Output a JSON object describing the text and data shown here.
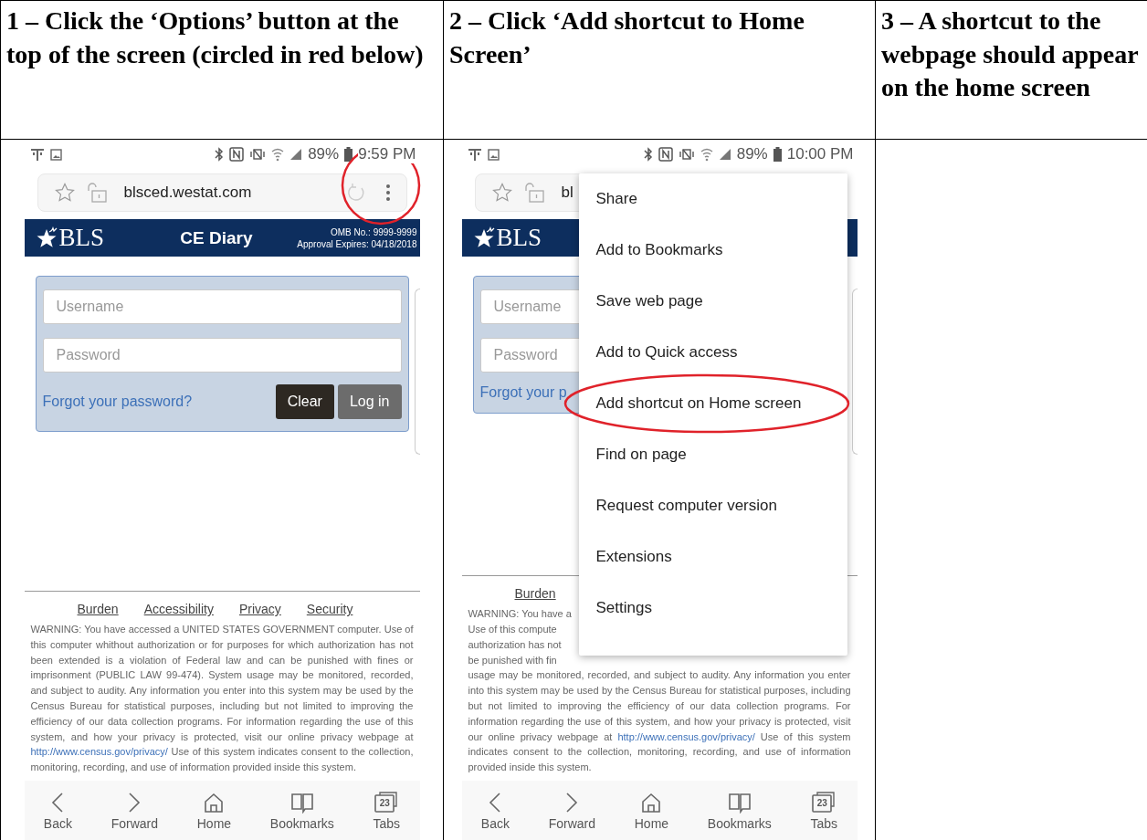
{
  "steps": [
    {
      "heading": "1 – Click the ‘Options’ button at the top of the screen (circled in red below)",
      "screenshot": {
        "battery": "89%",
        "time": "9:59 PM",
        "url": "blsced.westat.com",
        "address_icons": [
          {
            "kind": "star"
          },
          {
            "kind": "lock"
          },
          {
            "kind": "reload"
          },
          {
            "kind": "options"
          }
        ],
        "options_circled": true,
        "logo": "BLS",
        "title": "CE Diary",
        "omb": "OMB No.: 9999-9999",
        "approval": "Approval Expires: 04/18/2018",
        "username_placeholder": "Username",
        "password_placeholder": "Password",
        "forgot_link": "Forgot your password?",
        "buttons": [
          {
            "label": "Clear",
            "kind": "dark"
          },
          {
            "label": "Log in",
            "kind": "grey"
          }
        ],
        "footer_links": [
          "Burden",
          "Accessibility",
          "Privacy",
          "Security"
        ],
        "warning": {
          "before": "WARNING: You have accessed a UNITED STATES GOVERNMENT computer. Use of this computer whithout authorization or for purposes for which authorization has not been extended is a violation of Federal law and can be punished with fines or imprisonment (PUBLIC LAW 99-474). System usage may be monitored, recorded, and subject to audity. Any information you enter into this system may be used by the Census Bureau for statistical purposes, including but not limited to improving the efficiency of our data collection programs. For information regarding the use of this system, and how your privacy is protected, visit our online privacy webpage at",
          "link": "http://www.census.gov/privacy/",
          "after": "Use of this system indicates consent to the collection, monitoring, recording, and use of information provided inside this system."
        },
        "nav": [
          {
            "label": "Back",
            "kind": "back"
          },
          {
            "label": "Forward",
            "kind": "forward"
          },
          {
            "label": "Home",
            "kind": "home"
          },
          {
            "label": "Bookmarks",
            "kind": "bookmarks"
          },
          {
            "label": "Tabs",
            "kind": "tabs",
            "count": "23"
          }
        ]
      }
    },
    {
      "heading": "2 – Click ‘Add shortcut to Home Screen’",
      "screenshot": {
        "battery": "89%",
        "time": "10:00 PM",
        "url": "bl",
        "address_icons": [
          {
            "kind": "star"
          },
          {
            "kind": "lock"
          }
        ],
        "logo": "BLS",
        "username_placeholder": "Username",
        "password_placeholder": "Password",
        "forgot_link": "Forgot your p",
        "footer_links": [
          "Burden"
        ],
        "warning_cut_lines": [
          "WARNING: You have a",
          "Use of this compute",
          "authorization has not",
          "be punished with fin"
        ],
        "warning": {
          "before": "usage may be monitored, recorded, and subject to audity. Any information you enter into this system may be used by the Census Bureau for statistical purposes, including but not limited to improving the efficiency of our data collection programs. For information regarding the use of this system, and how your privacy is protected, visit our online privacy webpage at",
          "link": "http://www.census.gov/privacy/",
          "after": "Use of this system indicates consent to the collection, monitoring, recording, and use of information provided inside this system."
        },
        "menu": [
          {
            "label": "Share",
            "circled": false
          },
          {
            "label": "Add to Bookmarks",
            "circled": false
          },
          {
            "label": "Save web page",
            "circled": false
          },
          {
            "label": "Add to Quick access",
            "circled": false
          },
          {
            "label": "Add shortcut on Home screen",
            "circled": true
          },
          {
            "label": "Find on page",
            "circled": false
          },
          {
            "label": "Request computer version",
            "circled": false
          },
          {
            "label": "Extensions",
            "circled": false
          },
          {
            "label": "Settings",
            "circled": false
          }
        ],
        "nav": [
          {
            "label": "Back",
            "kind": "back"
          },
          {
            "label": "Forward",
            "kind": "forward"
          },
          {
            "label": "Home",
            "kind": "home"
          },
          {
            "label": "Bookmarks",
            "kind": "bookmarks"
          },
          {
            "label": "Tabs",
            "kind": "tabs",
            "count": "23"
          }
        ]
      }
    },
    {
      "heading": "3 – A shortcut to the webpage should appear on the home screen"
    }
  ]
}
